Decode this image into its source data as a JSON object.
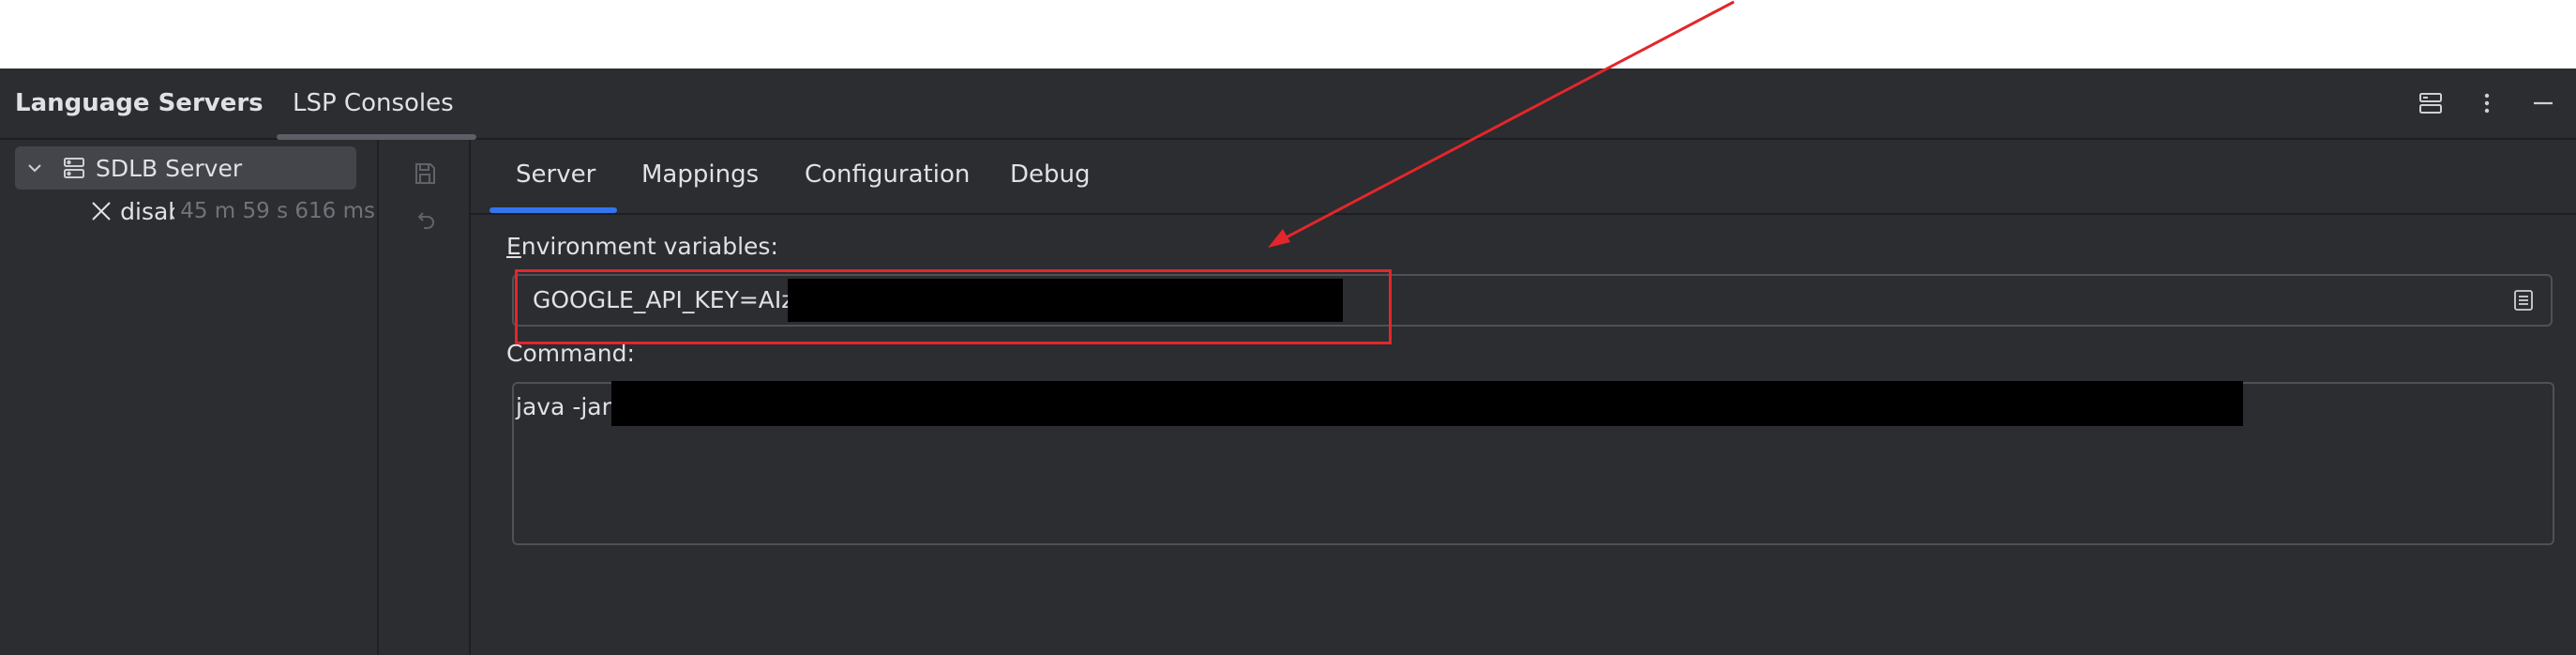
{
  "header": {
    "tabs": [
      {
        "label": "Language Servers",
        "active": true
      },
      {
        "label": "LSP Consoles",
        "active": false
      }
    ],
    "icons": [
      "layout-icon",
      "more-options-icon",
      "minimize-icon"
    ]
  },
  "tree": {
    "items": [
      {
        "label": "SDLB Server",
        "icon": "server-icon",
        "expanded": true,
        "selected": true
      },
      {
        "label": "disab",
        "time": "45 m 59 s 616 ms",
        "icon": "close-icon"
      }
    ]
  },
  "toolbar": {
    "icons": [
      "save-icon",
      "undo-icon"
    ]
  },
  "tabs": [
    "Server",
    "Mappings",
    "Configuration",
    "Debug"
  ],
  "active_tab": "Server",
  "env": {
    "label_first": "E",
    "label_rest": "nvironment variables:",
    "value": "GOOGLE_API_KEY=AIz"
  },
  "command": {
    "label": "Command:",
    "value": "java -jar"
  },
  "colors": {
    "panel_bg": "#2b2d30",
    "accent": "#3574f0",
    "annotation": "#e3262b",
    "text": "#dfe1e5",
    "muted_text": "#6f737a"
  }
}
